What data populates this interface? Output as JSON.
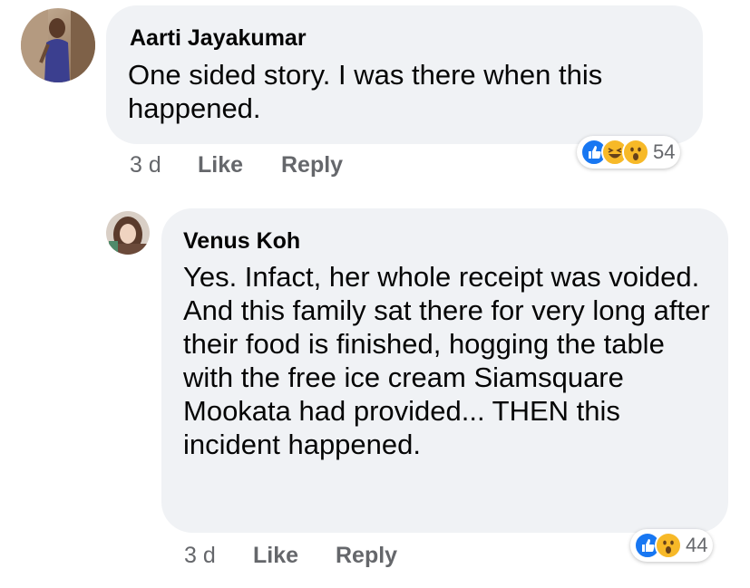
{
  "comments": [
    {
      "author": "Aarti Jayakumar",
      "text": "One sided story. I was there when this happened.",
      "time": "3 d",
      "like_label": "Like",
      "reply_label": "Reply",
      "reactions": [
        "like-icon",
        "haha-icon",
        "wow-icon"
      ],
      "reaction_count": "54"
    },
    {
      "author": "Venus Koh",
      "text": "Yes. Infact, her whole receipt was voided. And this family sat there for very long after their food is finished, hogging the table with the free ice cream Siamsquare Mookata had provided... THEN this incident happened.",
      "time": "3 d",
      "like_label": "Like",
      "reply_label": "Reply",
      "reactions": [
        "like-icon",
        "wow-icon"
      ],
      "reaction_count": "44"
    }
  ],
  "colors": {
    "bubble": "#f0f2f5",
    "meta_text": "#65676b",
    "like_blue": "#1877f2",
    "emoji_yellow": "#f7b928"
  }
}
